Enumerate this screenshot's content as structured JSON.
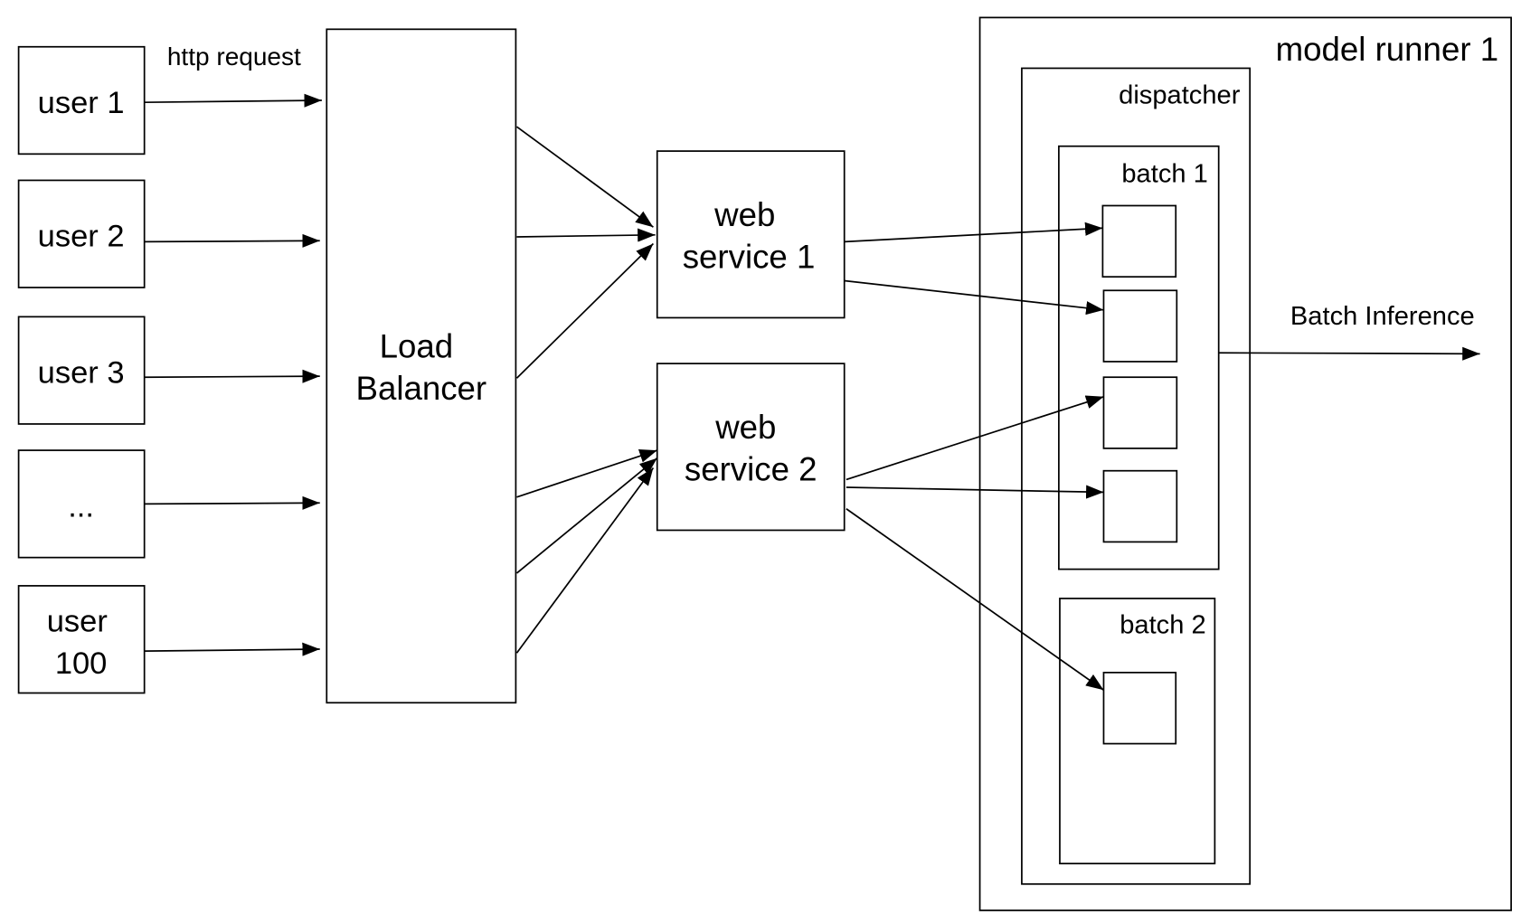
{
  "users": [
    {
      "lines": [
        "user 1"
      ]
    },
    {
      "lines": [
        "user 2"
      ]
    },
    {
      "lines": [
        "user 3"
      ]
    },
    {
      "lines": [
        "..."
      ]
    },
    {
      "lines": [
        "user",
        "100"
      ]
    }
  ],
  "http_label": "http request",
  "load_balancer": {
    "lines": [
      "Load",
      "Balancer"
    ]
  },
  "web_services": [
    {
      "lines": [
        "web",
        "service 1"
      ]
    },
    {
      "lines": [
        "web",
        "service 2"
      ]
    }
  ],
  "model_runner": {
    "label": "model runner 1"
  },
  "dispatcher": {
    "label": "dispatcher"
  },
  "batches": [
    {
      "label": "batch 1"
    },
    {
      "label": "batch 2"
    }
  ],
  "batch_inference_label": "Batch Inference"
}
